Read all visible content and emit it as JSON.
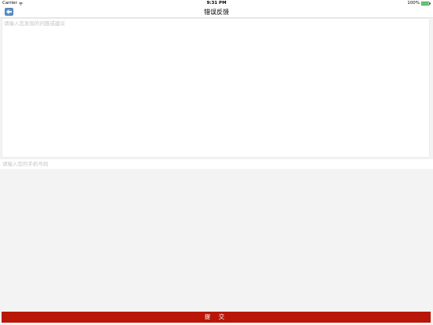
{
  "status_bar": {
    "carrier": "Carrier",
    "time": "9:31 PM",
    "battery_percent": "100%",
    "battery_level": 1.0,
    "wifi_icon": "wifi-icon",
    "battery_icon": "battery-icon",
    "battery_color": "#4cd964"
  },
  "nav": {
    "back_icon": "back-arrow-icon",
    "title": "错误反馈"
  },
  "feedback": {
    "placeholder": "请输入您发现的问题或建议",
    "value": ""
  },
  "phone": {
    "placeholder": "请输入您的手机号码",
    "value": ""
  },
  "submit": {
    "label": "提 交",
    "color": "#b91607"
  }
}
